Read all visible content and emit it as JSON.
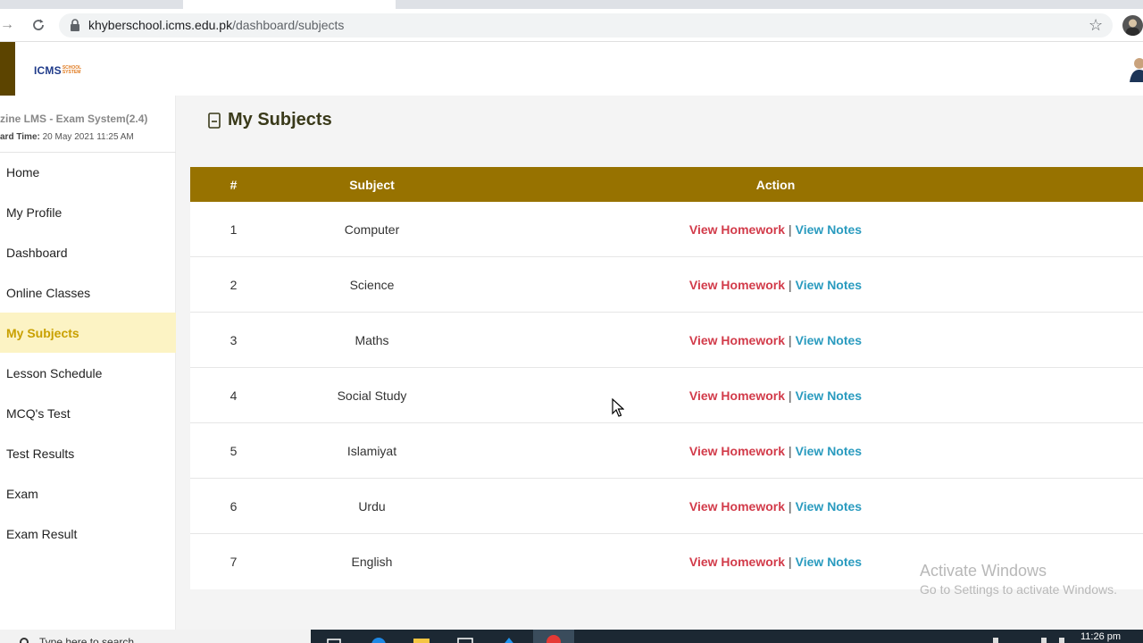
{
  "browser": {
    "url_host": "khyberschool.icms.edu.pk",
    "url_path": "/dashboard/subjects"
  },
  "header": {
    "logo_main": "ICMS",
    "logo_sub_1": "SCHOOL",
    "logo_sub_2": "SYSTEM"
  },
  "sidebar": {
    "system_title": "zine LMS - Exam System(2.4)",
    "time_label": "ard Time:",
    "time_value": "20 May 2021 11:25 AM",
    "items": [
      {
        "label": "Home"
      },
      {
        "label": "My Profile"
      },
      {
        "label": "Dashboard"
      },
      {
        "label": "Online Classes"
      },
      {
        "label": "My Subjects",
        "active": true
      },
      {
        "label": "Lesson Schedule"
      },
      {
        "label": "MCQ's Test"
      },
      {
        "label": "Test Results"
      },
      {
        "label": "Exam"
      },
      {
        "label": "Exam Result"
      }
    ]
  },
  "main": {
    "title": "My Subjects",
    "table": {
      "headers": [
        "#",
        "Subject",
        "Action"
      ],
      "action_homework": "View Homework",
      "action_separator": "|",
      "action_notes": "View Notes",
      "rows": [
        {
          "num": "1",
          "subject": "Computer"
        },
        {
          "num": "2",
          "subject": "Science"
        },
        {
          "num": "3",
          "subject": "Maths"
        },
        {
          "num": "4",
          "subject": "Social Study"
        },
        {
          "num": "5",
          "subject": "Islamiyat"
        },
        {
          "num": "6",
          "subject": "Urdu"
        },
        {
          "num": "7",
          "subject": "English"
        }
      ]
    }
  },
  "watermark": {
    "line1": "Activate Windows",
    "line2": "Go to Settings to activate Windows."
  },
  "taskbar": {
    "search_placeholder": "Type here to search",
    "clock": "11:26 pm"
  },
  "colors": {
    "header_bar": "#977200",
    "active_menu_bg": "#fcf3c4",
    "active_menu_text": "#c9a000",
    "link_homework": "#d23b4a",
    "link_notes": "#2a9bbf"
  }
}
